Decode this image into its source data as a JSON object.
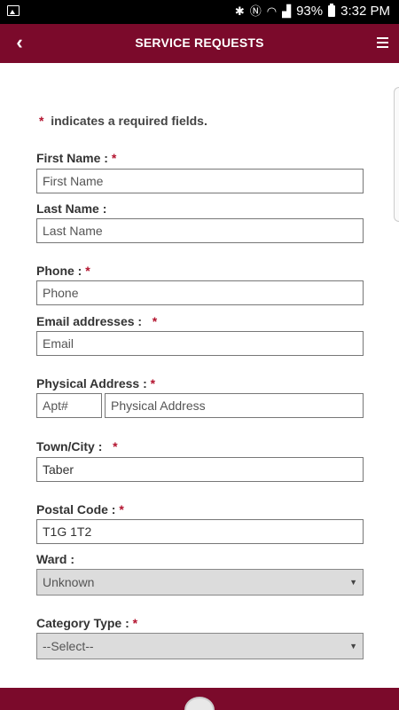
{
  "status_bar": {
    "battery": "93%",
    "time": "3:32 PM",
    "icons": [
      "image-icon",
      "bluetooth-icon",
      "nfc-icon",
      "wifi-icon",
      "signal-icon",
      "battery-icon"
    ]
  },
  "header": {
    "title": "SERVICE REQUESTS",
    "back_icon": "chevron-left-icon",
    "menu_icon": "hamburger-menu-icon",
    "color": "#7b0a2b"
  },
  "form": {
    "required_note": "indicates a required fields.",
    "required_marker": "*",
    "first_name": {
      "label": "First Name :",
      "placeholder": "First Name",
      "value": ""
    },
    "last_name": {
      "label": "Last Name :",
      "placeholder": "Last Name",
      "value": ""
    },
    "phone": {
      "label": "Phone :",
      "placeholder": "Phone",
      "value": ""
    },
    "email": {
      "label": "Email addresses :",
      "placeholder": "Email",
      "value": ""
    },
    "address": {
      "label": "Physical Address :",
      "apt_placeholder": "Apt#",
      "placeholder": "Physical Address"
    },
    "city": {
      "label": "Town/City :",
      "value": "Taber"
    },
    "postal_code": {
      "label": "Postal Code :",
      "value": "T1G 1T2"
    },
    "ward": {
      "label": "Ward :",
      "selected": "Unknown"
    },
    "category": {
      "label": "Category Type :",
      "selected": "--Select--"
    }
  }
}
